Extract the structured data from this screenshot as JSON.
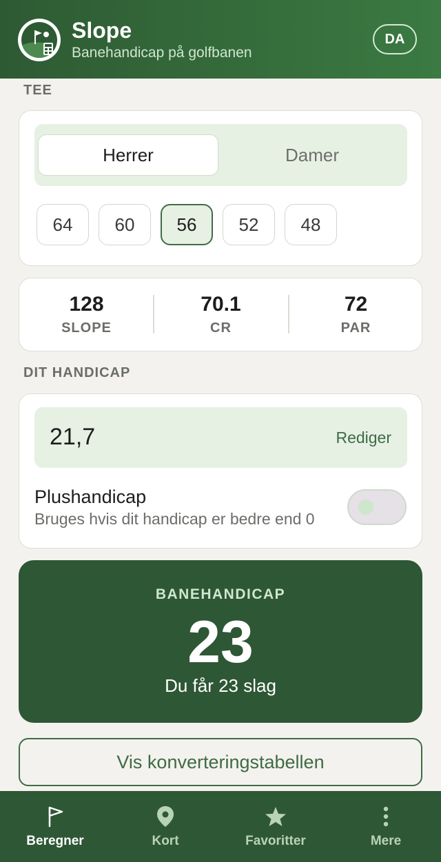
{
  "header": {
    "title": "Slope",
    "subtitle": "Banehandicap på golfbanen",
    "language": "DA"
  },
  "tee": {
    "section_label": "TEE",
    "gender_options": [
      "Herrer",
      "Damer"
    ],
    "selected_gender": "Herrer",
    "tee_values": [
      "64",
      "60",
      "56",
      "52",
      "48"
    ],
    "selected_tee": "56"
  },
  "stats": [
    {
      "value": "128",
      "label": "SLOPE"
    },
    {
      "value": "70.1",
      "label": "CR"
    },
    {
      "value": "72",
      "label": "PAR"
    }
  ],
  "handicap": {
    "section_label": "DIT HANDICAP",
    "value": "21,7",
    "edit_label": "Rediger",
    "plus_title": "Plushandicap",
    "plus_subtitle": "Bruges hvis dit handicap er bedre end 0",
    "plus_enabled": false
  },
  "result": {
    "label": "BANEHANDICAP",
    "value": "23",
    "description": "Du får 23 slag"
  },
  "conversion_button": "Vis konverteringstabellen",
  "nav": [
    {
      "label": "Beregner",
      "icon": "flag-icon",
      "active": true
    },
    {
      "label": "Kort",
      "icon": "map-pin-icon",
      "active": false
    },
    {
      "label": "Favoritter",
      "icon": "star-icon",
      "active": false
    },
    {
      "label": "Mere",
      "icon": "more-vertical-icon",
      "active": false
    }
  ],
  "colors": {
    "primary_dark": "#2e5735",
    "accent_green": "#3f6b45",
    "light_green": "#e6f1e4",
    "background": "#f4f2ee"
  }
}
